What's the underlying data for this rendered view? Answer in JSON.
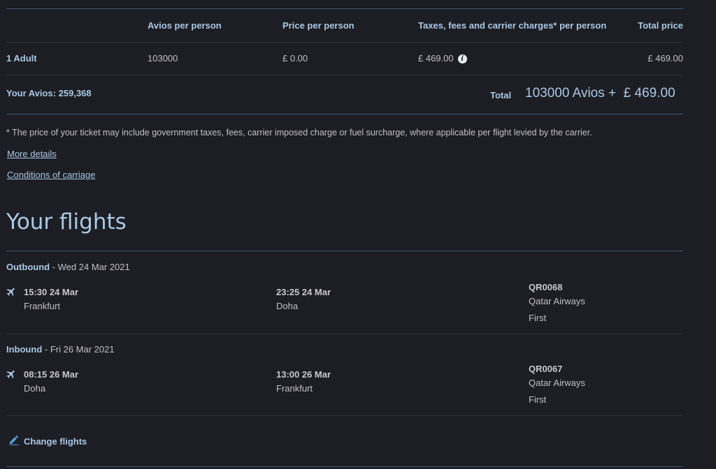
{
  "price_table": {
    "headers": {
      "avios": "Avios per person",
      "price": "Price per person",
      "taxes": "Taxes, fees and carrier charges* per person",
      "total": "Total price"
    },
    "row": {
      "label": "1 Adult",
      "avios": "103000",
      "price": "£ 0.00",
      "taxes": "£ 469.00",
      "total": "£ 469.00"
    }
  },
  "summary": {
    "your_avios": "Your Avios: 259,368",
    "total_label": "Total",
    "total_value": "103000 Avios +  £ 469.00"
  },
  "footnote": "* The price of your ticket may include government taxes, fees, carrier imposed charge or fuel surcharge, where applicable per flight levied by the carrier.",
  "links": {
    "more_details": "More details",
    "conditions": "Conditions of carriage"
  },
  "flights": {
    "heading": "Your flights",
    "outbound": {
      "label": "Outbound",
      "date": " - Wed 24 Mar 2021",
      "depart_time": "15:30 24 Mar",
      "depart_place": "Frankfurt",
      "arrive_time": "23:25 24 Mar",
      "arrive_place": "Doha",
      "flight_no": "QR0068",
      "airline": "Qatar Airways",
      "cabin": "First"
    },
    "inbound": {
      "label": "Inbound",
      "date": " - Fri 26 Mar 2021",
      "depart_time": "08:15 26 Mar",
      "depart_place": "Doha",
      "arrive_time": "13:00 26 Mar",
      "arrive_place": "Frankfurt",
      "flight_no": "QR0067",
      "airline": "Qatar Airways",
      "cabin": "First"
    },
    "change_label": "Change flights"
  },
  "icons": {
    "info": "info-icon",
    "plane": "plane-icon",
    "pencil": "pencil-icon"
  },
  "colors": {
    "background": "#1d1d24",
    "accent": "#a9c9e3",
    "divider": "#3d5a6e"
  }
}
